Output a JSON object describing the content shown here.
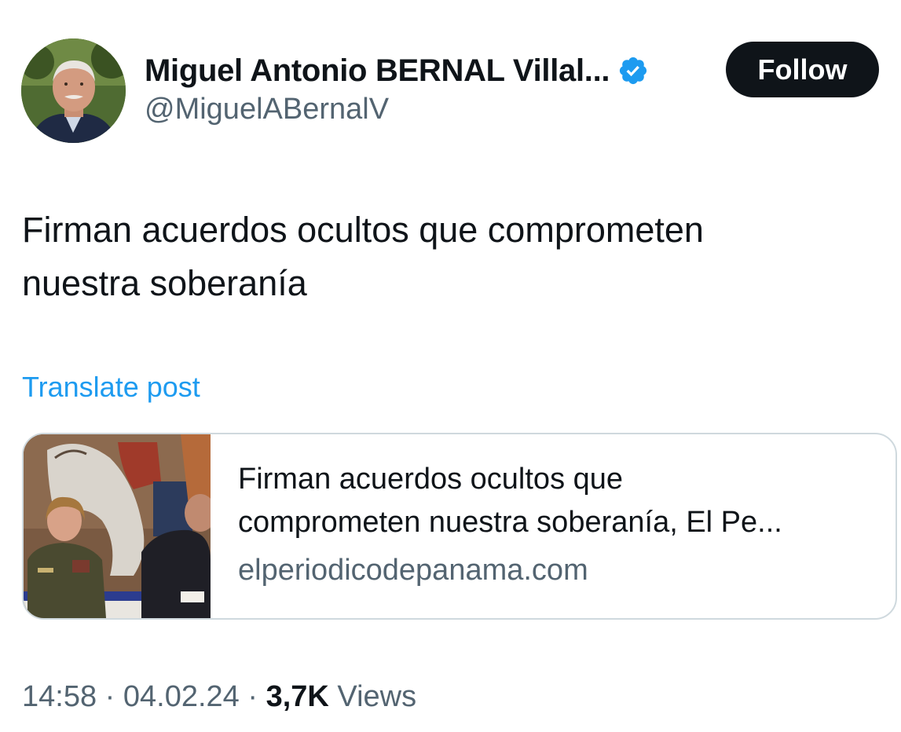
{
  "author": {
    "display_name": "Miguel Antonio BERNAL Villal...",
    "handle": "@MiguelABernalV",
    "verified_icon": "verified-badge-icon",
    "avatar_icon": "profile-avatar"
  },
  "follow_label": "Follow",
  "post": {
    "text_line1": "Firman acuerdos ocultos que comprometen",
    "text_line2": "nuestra soberanía",
    "translate_label": "Translate post"
  },
  "link_card": {
    "title_line1": "Firman acuerdos ocultos que",
    "title_line2": "comprometen nuestra soberanía, El Pe...",
    "domain": "elperiodicodepanama.com",
    "thumbnail_icon": "article-thumbnail"
  },
  "meta": {
    "time": "14:58",
    "separator": " · ",
    "date": "04.02.24",
    "views_count": "3,7K",
    "views_label": "Views"
  },
  "colors": {
    "accent": "#1d9bf0",
    "text": "#0f1419",
    "muted": "#536471",
    "border": "#cfd9de",
    "button_bg": "#0f1419"
  }
}
